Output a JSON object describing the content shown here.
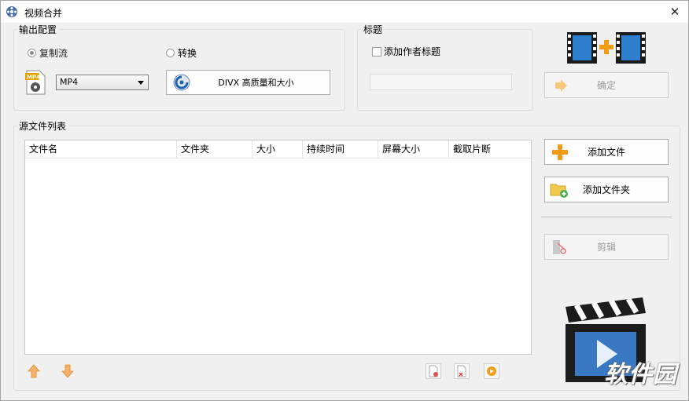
{
  "window": {
    "title": "视频合并",
    "close_symbol": "✕"
  },
  "output_config": {
    "label": "输出配置",
    "mode_copy": "复制流",
    "mode_convert": "转换",
    "format_value": "MP4",
    "format_icon_text": "MP4",
    "preset_label": "DIVX 高质量和大小"
  },
  "title_group": {
    "label": "标题",
    "add_author_title": "添加作者标题",
    "title_value": ""
  },
  "confirm_button": "确定",
  "source_list": {
    "label": "源文件列表",
    "columns": [
      "文件名",
      "文件夹",
      "大小",
      "持续时间",
      "屏幕大小",
      "截取片断"
    ]
  },
  "side_buttons": {
    "add_file": "添加文件",
    "add_folder": "添加文件夹",
    "trim": "剪辑"
  },
  "watermark": "软件园",
  "icons": {
    "app": "film-reel-icon",
    "merge": "film-plus-film-icon",
    "confirm": "arrow-right-icon",
    "add_file": "plus-icon",
    "add_folder": "folder-add-icon",
    "trim": "scissors-film-icon",
    "move_up": "arrow-up-icon",
    "move_down": "arrow-down-icon",
    "clapper": "clapperboard-icon"
  },
  "colors": {
    "accent_orange": "#f39c12",
    "film_blue": "#2f7fd0"
  }
}
